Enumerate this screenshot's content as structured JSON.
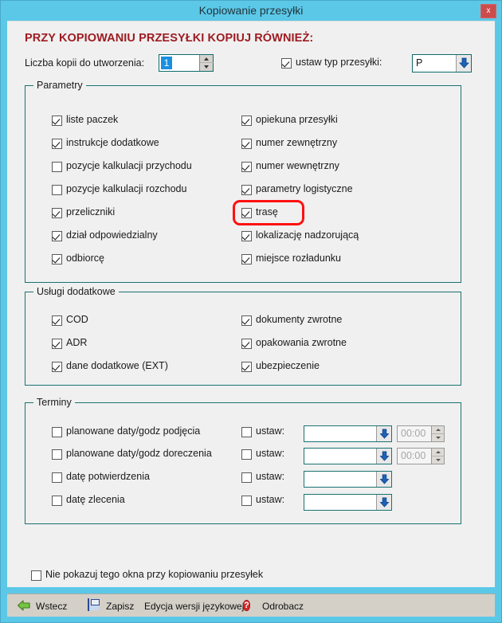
{
  "window": {
    "title": "Kopiowanie przesyłki",
    "close_label": "x",
    "heading": "PRZY KOPIOWANIU PRZESYŁKI KOPIUJ RÓWNIEŻ:",
    "accent_title_bg": "#5cc8e8",
    "heading_color": "#9d1c22",
    "group_border_color": "#1a7272",
    "highlight_color": "#ff1010"
  },
  "top_row": {
    "copies_label": "Liczba kopii do utworzenia:",
    "copies_value": "1",
    "set_type_label": "ustaw typ przesyłki:",
    "set_type_checked": true,
    "type_value": "P"
  },
  "parametry": {
    "legend": "Parametry",
    "left": [
      {
        "label": "liste paczek",
        "checked": true
      },
      {
        "label": "instrukcje dodatkowe",
        "checked": true
      },
      {
        "label": "pozycje kalkulacji przychodu",
        "checked": false
      },
      {
        "label": "pozycje kalkulacji rozchodu",
        "checked": false
      },
      {
        "label": "przeliczniki",
        "checked": true
      },
      {
        "label": "dział odpowiedzialny",
        "checked": true
      },
      {
        "label": "odbiorcę",
        "checked": true
      }
    ],
    "right": [
      {
        "label": "opiekuna przesyłki",
        "checked": true
      },
      {
        "label": "numer zewnętrzny",
        "checked": true
      },
      {
        "label": "numer wewnętrzny",
        "checked": true
      },
      {
        "label": "parametry logistyczne",
        "checked": true
      },
      {
        "label": "trasę",
        "checked": true,
        "highlighted": true
      },
      {
        "label": "lokalizację nadzorującą",
        "checked": true
      },
      {
        "label": "miejsce rozładunku",
        "checked": true
      }
    ]
  },
  "uslugi": {
    "legend": "Usługi dodatkowe",
    "left": [
      {
        "label": "COD",
        "checked": true
      },
      {
        "label": "ADR",
        "checked": true
      },
      {
        "label": "dane dodatkowe (EXT)",
        "checked": true
      }
    ],
    "right": [
      {
        "label": "dokumenty zwrotne",
        "checked": true
      },
      {
        "label": "opakowania zwrotne",
        "checked": true
      },
      {
        "label": "ubezpieczenie",
        "checked": true
      }
    ]
  },
  "terminy": {
    "legend": "Terminy",
    "set_label": "ustaw:",
    "rows": [
      {
        "label": "planowane daty/godz podjęcia",
        "checked": false,
        "set_checked": false,
        "date_value": "",
        "time_value": "00:00",
        "has_time": true
      },
      {
        "label": "planowane daty/godz doreczenia",
        "checked": false,
        "set_checked": false,
        "date_value": "",
        "time_value": "00:00",
        "has_time": true
      },
      {
        "label": "datę potwierdzenia",
        "checked": false,
        "set_checked": false,
        "date_value": "",
        "has_time": false
      },
      {
        "label": "datę zlecenia",
        "checked": false,
        "set_checked": false,
        "date_value": "",
        "has_time": false
      }
    ]
  },
  "footer": {
    "dont_show_label": "Nie pokazuj tego okna przy kopiowaniu przesyłek",
    "dont_show_checked": false
  },
  "toolbar": {
    "back_label": "Wstecz",
    "save_label": "Zapisz",
    "lang_label": "Edycja wersji językowej",
    "help_label": "Odrobacz"
  }
}
